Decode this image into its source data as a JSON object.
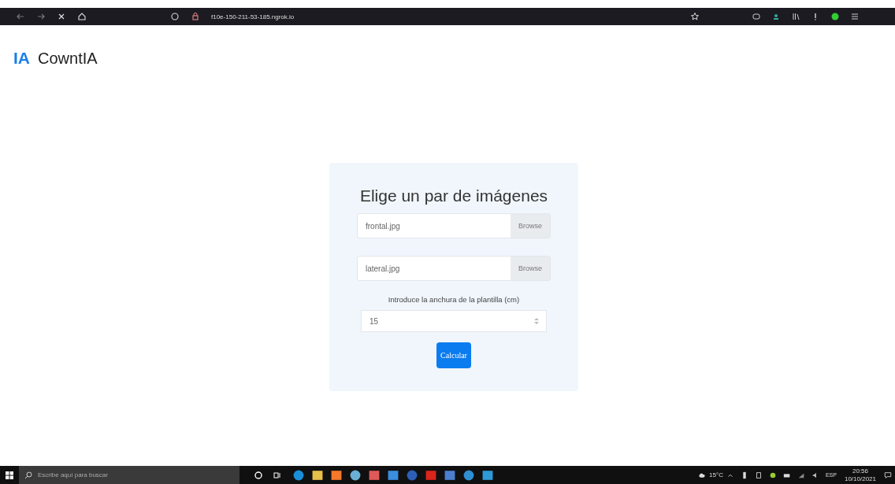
{
  "browser": {
    "url": "f10e-150-211-53-185.ngrok.io"
  },
  "header": {
    "logo": "IA",
    "title": "CowntIA"
  },
  "form": {
    "title": "Elige un par de imágenes",
    "files": [
      {
        "filename": "frontal.jpg",
        "button": "Browse"
      },
      {
        "filename": "lateral.jpg",
        "button": "Browse"
      }
    ],
    "width_label": "Introduce la anchura de la plantilla (cm)",
    "width_value": "15",
    "submit": "Calcular"
  },
  "taskbar": {
    "search_placeholder": "Escribe aquí para buscar",
    "weather": "15°C",
    "language": "ESP",
    "time": "20:56",
    "date": "10/10/2021"
  }
}
